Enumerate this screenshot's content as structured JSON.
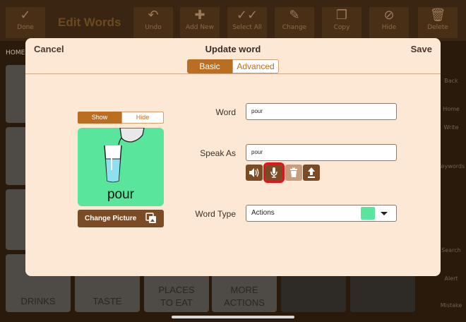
{
  "toolbar": {
    "done_label": "Done",
    "title": "Edit Words",
    "buttons": [
      {
        "label": "Undo",
        "icon": "undo-icon"
      },
      {
        "label": "Add New",
        "icon": "plus-icon"
      },
      {
        "label": "Select All",
        "icon": "double-check-icon"
      },
      {
        "label": "Change",
        "icon": "pencil-icon"
      },
      {
        "label": "Copy",
        "icon": "copy-icon"
      },
      {
        "label": "Hide",
        "icon": "hide-icon"
      },
      {
        "label": "Delete",
        "icon": "trash-icon"
      }
    ]
  },
  "breadcrumb": "HOME",
  "background_tiles": [
    {
      "label": "DRINKS"
    },
    {
      "label": "TASTE"
    },
    {
      "label": "PLACES TO EAT"
    },
    {
      "label": "MORE ACTIONS"
    }
  ],
  "right_panel": [
    "Back",
    "Home",
    "Write",
    "Keywords",
    "Search",
    "Alert",
    "Mistake"
  ],
  "modal": {
    "cancel": "Cancel",
    "title": "Update word",
    "save": "Save",
    "tabs": [
      "Basic",
      "Advanced"
    ],
    "active_tab": "Basic",
    "show_label": "Show",
    "hide_label": "Hide",
    "picture_caption": "pour",
    "change_picture": "Change Picture",
    "word_label": "Word",
    "word_value": "pour",
    "speak_as_label": "Speak As",
    "speak_as_value": "pour",
    "word_type_label": "Word Type",
    "word_type_value": "Actions",
    "word_type_color": "#59e59c",
    "speak_buttons": [
      "speaker-icon",
      "microphone-icon",
      "trash-icon",
      "upload-icon"
    ]
  },
  "colors": {
    "accent": "#b96e21",
    "button_brown": "#7b4b26",
    "modal_bg": "#fde8d5",
    "picture_bg": "#59e59c",
    "highlight": "#e3121b"
  }
}
